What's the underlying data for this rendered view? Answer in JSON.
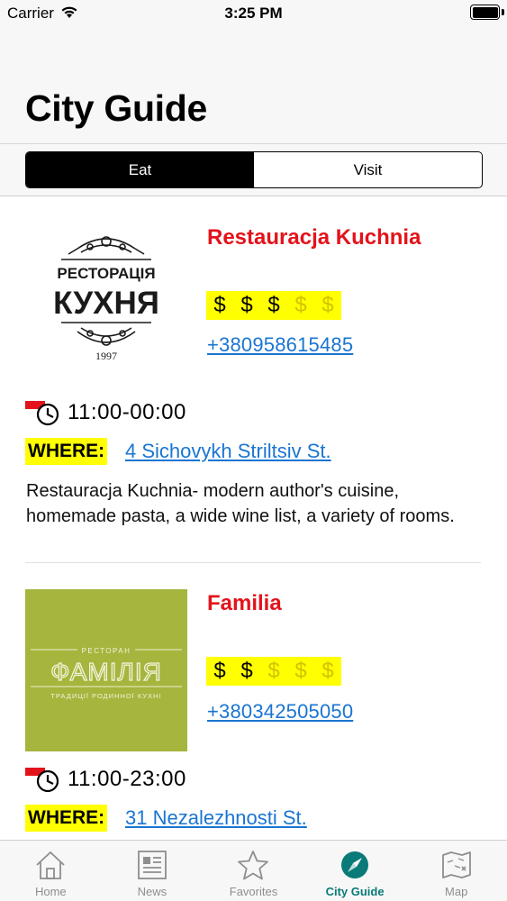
{
  "status_bar": {
    "carrier": "Carrier",
    "time": "3:25 PM"
  },
  "header": {
    "title": "City Guide"
  },
  "segmented": {
    "eat_label": "Eat",
    "visit_label": "Visit",
    "selected": "Eat"
  },
  "places": [
    {
      "name": "Restauracja Kuchnia",
      "logo_text": {
        "top": "РЕСТОРАЦІЯ",
        "main": "КУХНЯ",
        "year": "1997"
      },
      "price_level": 3,
      "price_symbols": [
        "$",
        "$",
        "$",
        "$",
        "$"
      ],
      "phone": "+380958615485",
      "hours": "11:00-00:00",
      "where_label": "WHERE:",
      "address": "4 Sichovykh Striltsiv St.",
      "description": "Restauracja Kuchnia- modern author's cuisine, homemade pasta, a wide wine list, a variety of rooms."
    },
    {
      "name": "Familia",
      "logo_text": {
        "top": "РЕСТОРАН",
        "main": "ФАМІЛІЯ",
        "bottom": "ТРАДИЦІЇ РОДИННОЇ КУХНІ"
      },
      "price_level": 2,
      "price_symbols": [
        "$",
        "$",
        "$",
        "$",
        "$"
      ],
      "phone": "+380342505050",
      "hours": "11:00-23:00",
      "where_label": "WHERE:",
      "address": "31 Nezalezhnosti St."
    }
  ],
  "tab_bar": {
    "items": [
      {
        "label": "Home",
        "icon": "home-icon"
      },
      {
        "label": "News",
        "icon": "news-icon"
      },
      {
        "label": "Favorites",
        "icon": "star-icon"
      },
      {
        "label": "City Guide",
        "icon": "compass-icon",
        "active": true
      },
      {
        "label": "Map",
        "icon": "map-icon"
      }
    ]
  },
  "colors": {
    "accent_red": "#e3131b",
    "highlight_yellow": "#ffff00",
    "link_blue": "#1a75d2",
    "tab_active": "#0a7a78",
    "familia_green": "#a5b53d"
  }
}
